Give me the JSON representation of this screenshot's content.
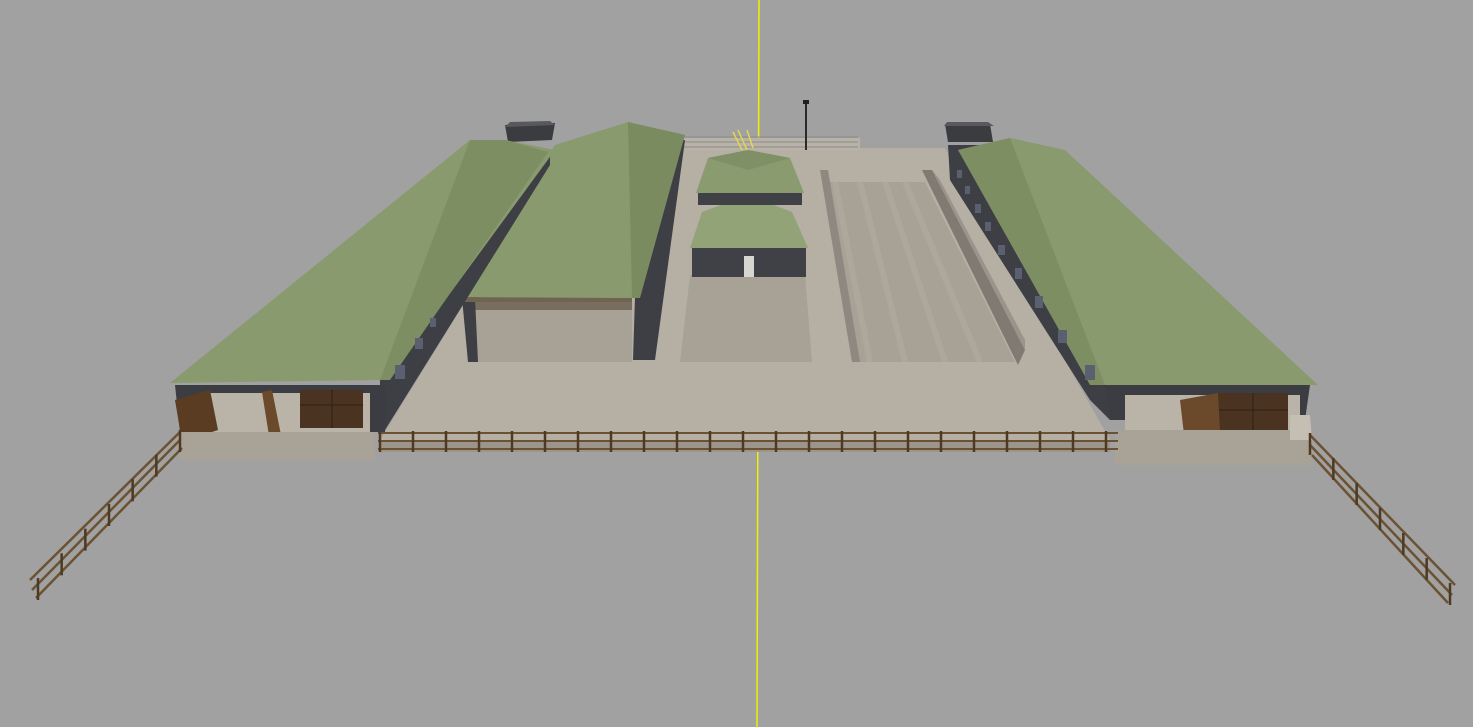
{
  "viewport": {
    "background": "#a1a1a1",
    "axis_color": "#f0f000"
  },
  "colors": {
    "roof": "#889a6e",
    "roof_shade": "#76865d",
    "wall": "#3d3f44",
    "wall_dark": "#2e3034",
    "concrete": "#b4aea3",
    "concrete_dark": "#9d978d",
    "silo_floor": "#a39d92",
    "silo_wall": "#8d877e",
    "fence": "#6b5233",
    "fence_post": "#4e3a22",
    "door": "#4a3320"
  },
  "scene": {
    "objects": [
      "left-barn",
      "open-shed",
      "center-building",
      "bunker-silo",
      "right-barn",
      "perimeter-fence",
      "manure-bins",
      "lamp-post"
    ]
  }
}
